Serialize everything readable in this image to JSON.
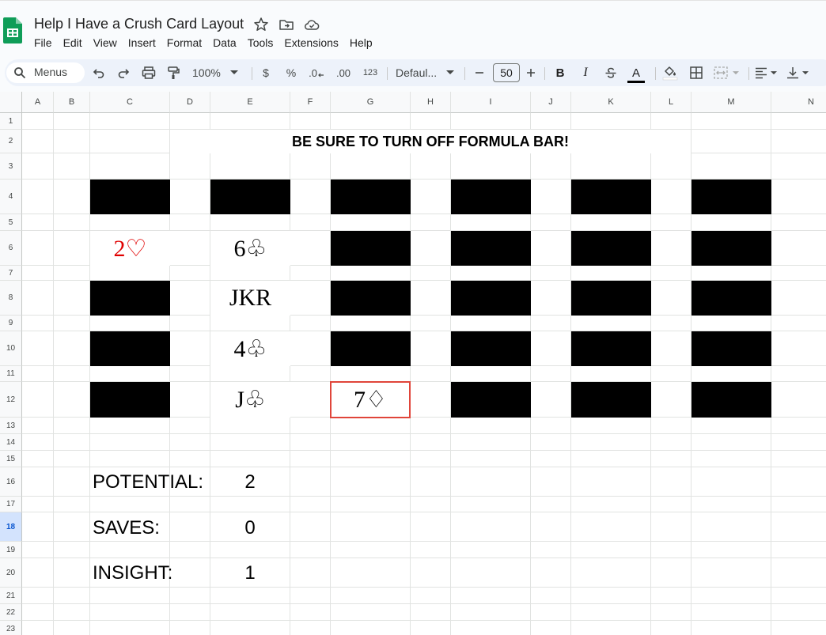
{
  "document": {
    "title": "Help I Have a Crush Card Layout"
  },
  "menu": [
    "File",
    "Edit",
    "View",
    "Insert",
    "Format",
    "Data",
    "Tools",
    "Extensions",
    "Help"
  ],
  "toolbar": {
    "search_label": "Menus",
    "zoom": "100%",
    "currency": "$",
    "percent": "%",
    "decrease_decimal": ".0",
    "increase_decimal": ".00",
    "number_format": "123",
    "font": "Defaul...",
    "font_size": "50",
    "bold": "B",
    "italic": "I",
    "text_color_letter": "A"
  },
  "sheet": {
    "columns": [
      "A",
      "B",
      "C",
      "D",
      "E",
      "F",
      "G",
      "H",
      "I",
      "J",
      "K",
      "L",
      "M",
      "N"
    ],
    "rows": [
      "1",
      "2",
      "3",
      "4",
      "5",
      "6",
      "7",
      "8",
      "9",
      "10",
      "11",
      "12",
      "13",
      "14",
      "15",
      "16",
      "17",
      "18",
      "19",
      "20",
      "21",
      "22",
      "23"
    ],
    "active_row": "18",
    "banner": "BE SURE TO TURN OFF FORMULA BAR!",
    "face_up_cards": {
      "c6": "2♡",
      "e6": "6♧",
      "e8": "JKR",
      "e10": "4♧",
      "e12": "J♧",
      "g12": "7♢"
    },
    "stats": {
      "potential_label": "POTENTIAL:",
      "potential_value": "2",
      "saves_label": "SAVES:",
      "saves_value": "0",
      "insight_label": "INSIGHT:",
      "insight_value": "1"
    }
  },
  "colors": {
    "card_back": "#000000",
    "red_suit": "#e00000",
    "selection_border": "#e0453a",
    "active_row_header": "#d3e3fd",
    "sheets_green": "#0f9d58"
  },
  "icons": [
    "sheets-logo-icon",
    "star-icon",
    "move-to-folder-icon",
    "cloud-status-icon",
    "search-icon",
    "undo-icon",
    "redo-icon",
    "print-icon",
    "paint-format-icon",
    "dropdown-caret-icon",
    "minus-icon",
    "plus-icon",
    "strikethrough-icon",
    "fill-color-icon",
    "borders-icon",
    "merge-cells-icon",
    "align-left-icon",
    "vertical-align-bottom-icon"
  ]
}
